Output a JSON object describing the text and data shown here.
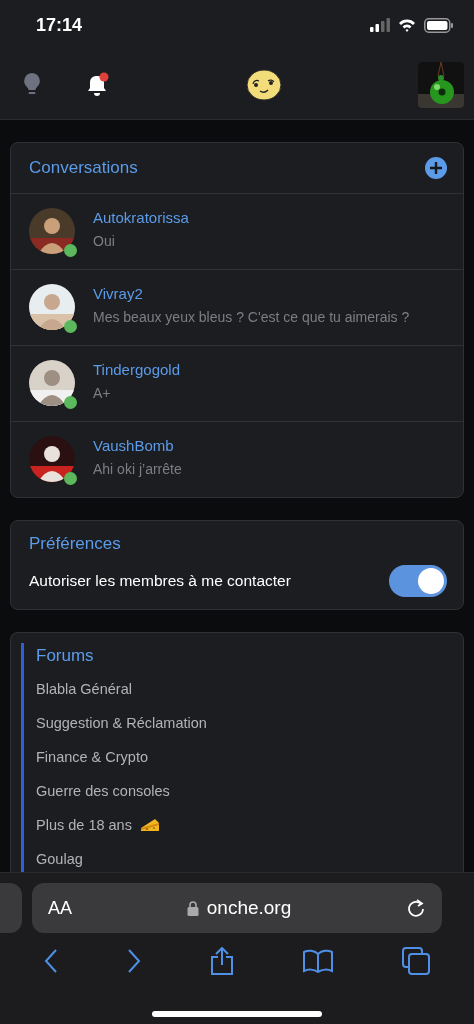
{
  "status_bar": {
    "time": "17:14"
  },
  "header": {
    "notification_badge": true
  },
  "conversations": {
    "title": "Conversations",
    "items": [
      {
        "name": "Autokratorissa",
        "message": "Oui",
        "online": true
      },
      {
        "name": "Vivray2",
        "message": "Mes beaux yeux bleus ? C'est ce que tu aimerais ?",
        "online": true
      },
      {
        "name": "Tindergogold",
        "message": "A+",
        "online": true
      },
      {
        "name": "VaushBomb",
        "message": "Ahi oki j’arrête",
        "online": true
      }
    ]
  },
  "preferences": {
    "title": "Préférences",
    "settings": [
      {
        "label": "Autoriser les membres à me contacter",
        "on": true
      }
    ]
  },
  "forums": {
    "title": "Forums",
    "items": [
      {
        "label": "Blabla Général"
      },
      {
        "label": "Suggestion & Réclamation"
      },
      {
        "label": "Finance & Crypto"
      },
      {
        "label": "Guerre des consoles"
      },
      {
        "label": "Plus de 18 ans",
        "kind": "cheese"
      },
      {
        "label": "Goulag"
      }
    ]
  },
  "browser": {
    "text_size": "AA",
    "url": "onche.org"
  }
}
